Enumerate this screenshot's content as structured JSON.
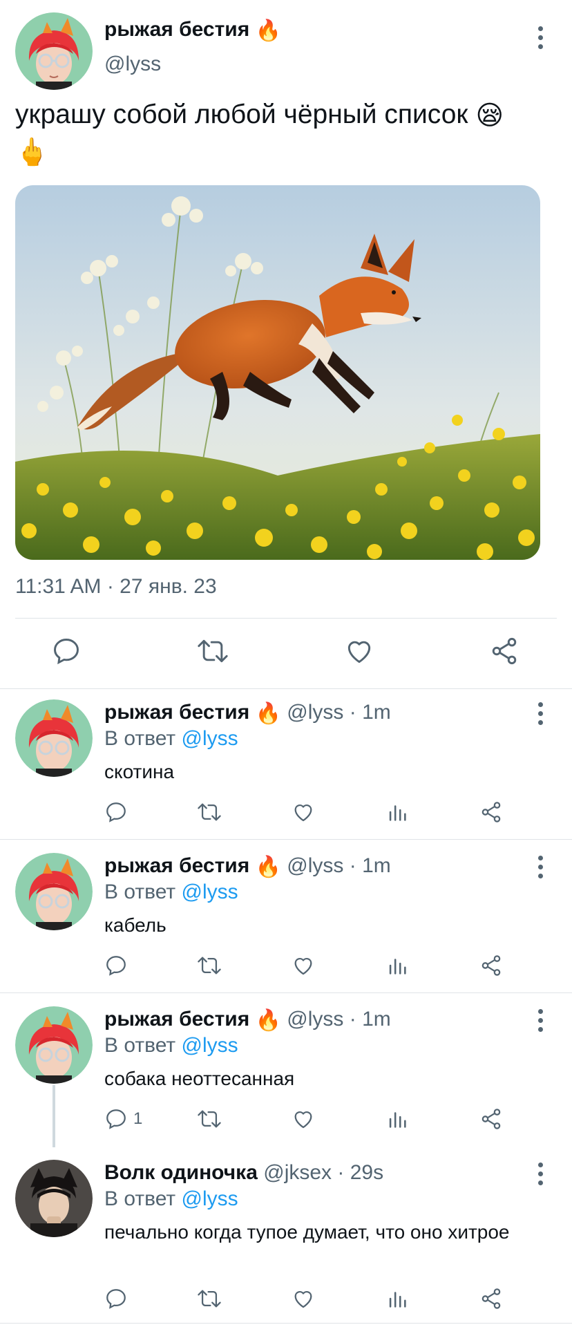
{
  "main_tweet": {
    "author_name": "рыжая бестия",
    "author_emoji": "🔥",
    "handle": "@lyss",
    "text_line1": "украшу собой  любой чёрный список",
    "text_emoji1": "😪",
    "text_emoji2": "🖕",
    "timestamp": "11:31 AM · 27 янв. 23",
    "image_icon": "fox-jumping-in-flower-field",
    "actions": [
      "reply-icon",
      "retweet-icon",
      "like-icon",
      "share-icon"
    ]
  },
  "replies": [
    {
      "author_name": "рыжая бестия",
      "author_emoji": "🔥",
      "handle_time": "@lyss · 1m",
      "reply_prefix": "В ответ ",
      "reply_mention": "@lyss",
      "text": "скотина",
      "reply_count": ""
    },
    {
      "author_name": "рыжая бестия",
      "author_emoji": "🔥",
      "handle_time": "@lyss · 1m",
      "reply_prefix": "В ответ ",
      "reply_mention": "@lyss",
      "text": "кабель",
      "reply_count": ""
    },
    {
      "author_name": "рыжая бестия",
      "author_emoji": "🔥",
      "handle_time": "@lyss · 1m",
      "reply_prefix": "В ответ ",
      "reply_mention": "@lyss",
      "text": "собака неоттесанная",
      "reply_count": "1"
    },
    {
      "author_name": "Волк одиночка",
      "author_emoji": "",
      "handle_time": "@jksex · 29s",
      "reply_prefix": "В ответ ",
      "reply_mention": "@lyss",
      "text": "печально когда  тупое думает,  что оно хитрое",
      "reply_count": ""
    }
  ],
  "colors": {
    "text_primary": "#0f1419",
    "text_secondary": "#536471",
    "accent": "#1d9bf0",
    "divider": "#dfe3e7"
  }
}
